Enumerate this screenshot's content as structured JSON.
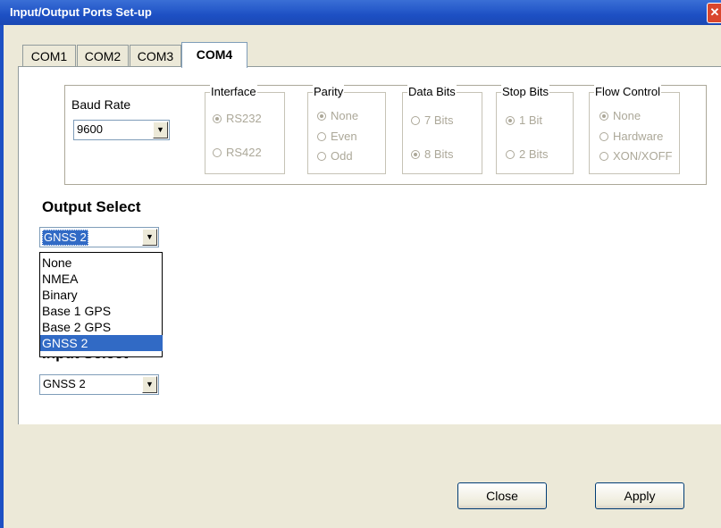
{
  "window": {
    "title": "Input/Output Ports Set-up",
    "close_glyph": "✕"
  },
  "tabs": [
    {
      "label": "COM1",
      "active": false
    },
    {
      "label": "COM2",
      "active": false
    },
    {
      "label": "COM3",
      "active": false
    },
    {
      "label": "COM4",
      "active": true
    }
  ],
  "baud_rate": {
    "label": "Baud Rate",
    "value": "9600"
  },
  "interface": {
    "label": "Interface",
    "options": [
      "RS232",
      "RS422"
    ],
    "selected": "RS232"
  },
  "parity": {
    "label": "Parity",
    "options": [
      "None",
      "Even",
      "Odd"
    ],
    "selected": "None"
  },
  "data_bits": {
    "label": "Data Bits",
    "options": [
      "7 Bits",
      "8 Bits"
    ],
    "selected": "8 Bits"
  },
  "stop_bits": {
    "label": "Stop Bits",
    "options": [
      "1 Bit",
      "2 Bits"
    ],
    "selected": "1 Bit"
  },
  "flow_control": {
    "label": "Flow Control",
    "options": [
      "None",
      "Hardware",
      "XON/XOFF"
    ],
    "selected": "None"
  },
  "output_select": {
    "label": "Output Select",
    "value": "GNSS 2",
    "options": [
      "None",
      "NMEA",
      "Binary",
      "Base 1 GPS",
      "Base 2 GPS",
      "GNSS 2"
    ],
    "highlighted": "GNSS 2"
  },
  "input_select": {
    "label": "Input Select",
    "value": "GNSS 2"
  },
  "buttons": {
    "close": "Close",
    "apply": "Apply"
  },
  "colors": {
    "titlebar": "#1d50c4",
    "selection": "#316ac5",
    "dialog_bg": "#ece9d8"
  }
}
